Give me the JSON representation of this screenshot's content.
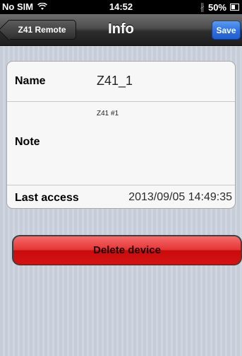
{
  "status_bar": {
    "carrier": "No SIM",
    "time": "14:52",
    "battery": "50%",
    "icons": [
      "wifi-icon",
      "bluetooth-icon",
      "battery-icon"
    ]
  },
  "nav": {
    "back_label": "Z41 Remote",
    "title": "Info",
    "save_label": "Save"
  },
  "details": {
    "name_label": "Name",
    "name_value": "Z41_1",
    "note_label": "Note",
    "note_value": "Z41 #1",
    "last_access_label": "Last access",
    "last_access_value": "2013/09/05 14:49:35"
  },
  "actions": {
    "delete_label": "Delete device"
  },
  "colors": {
    "save_button": "#2f6fe0",
    "delete_button": "#e63535",
    "background": "#cbd2dc"
  }
}
